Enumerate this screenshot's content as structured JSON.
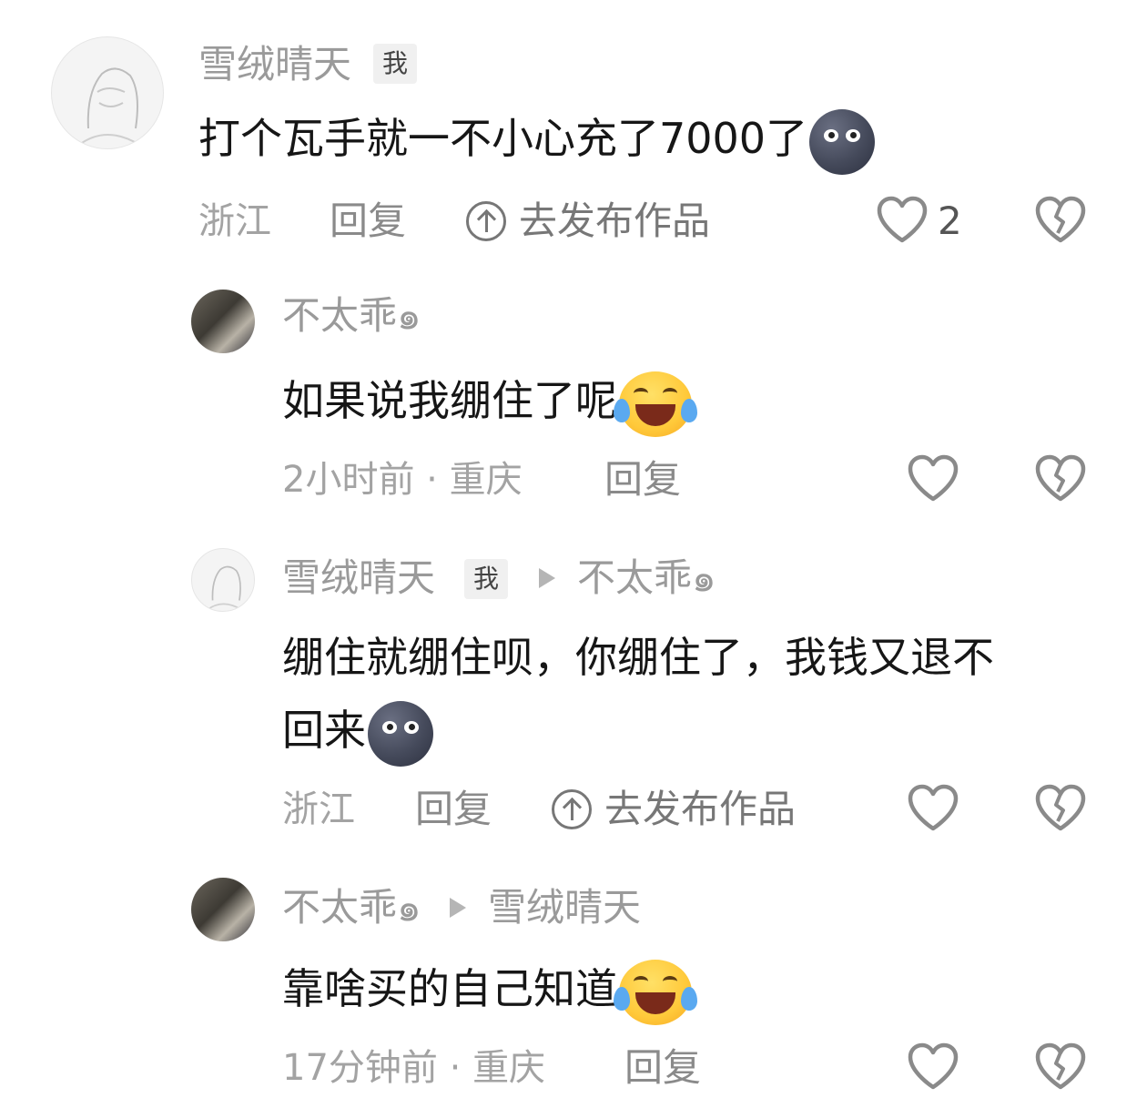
{
  "comments": [
    {
      "avatar": "sketch-girl-avatar",
      "username": "雪绒晴天",
      "badge": "我",
      "text": "打个瓦手就一不小心充了7000了",
      "emoji": "new-moon-face-emoji",
      "location": "浙江",
      "reply_label": "回复",
      "publish_label": "去发布作品",
      "like_count": "2"
    },
    {
      "avatar": "photo-avatar",
      "username": "不太乖๑",
      "text": "如果说我绷住了呢",
      "emoji": "laughing-tears-emoji",
      "time": "2小时前",
      "separator": "·",
      "location": "重庆",
      "reply_label": "回复"
    },
    {
      "avatar": "sketch-girl-avatar",
      "username": "雪绒晴天",
      "badge": "我",
      "reply_to": "不太乖๑",
      "text_line1": "绷住就绷住呗，你绷住了，我钱又退不",
      "text_line2": "回来",
      "emoji": "new-moon-face-emoji",
      "location": "浙江",
      "reply_label": "回复",
      "publish_label": "去发布作品"
    },
    {
      "avatar": "photo-avatar",
      "username": "不太乖๑",
      "reply_to": "雪绒晴天",
      "text": "靠啥买的自己知道",
      "emoji": "laughing-tears-emoji",
      "time": "17分钟前",
      "separator": "·",
      "location": "重庆",
      "reply_label": "回复"
    }
  ]
}
